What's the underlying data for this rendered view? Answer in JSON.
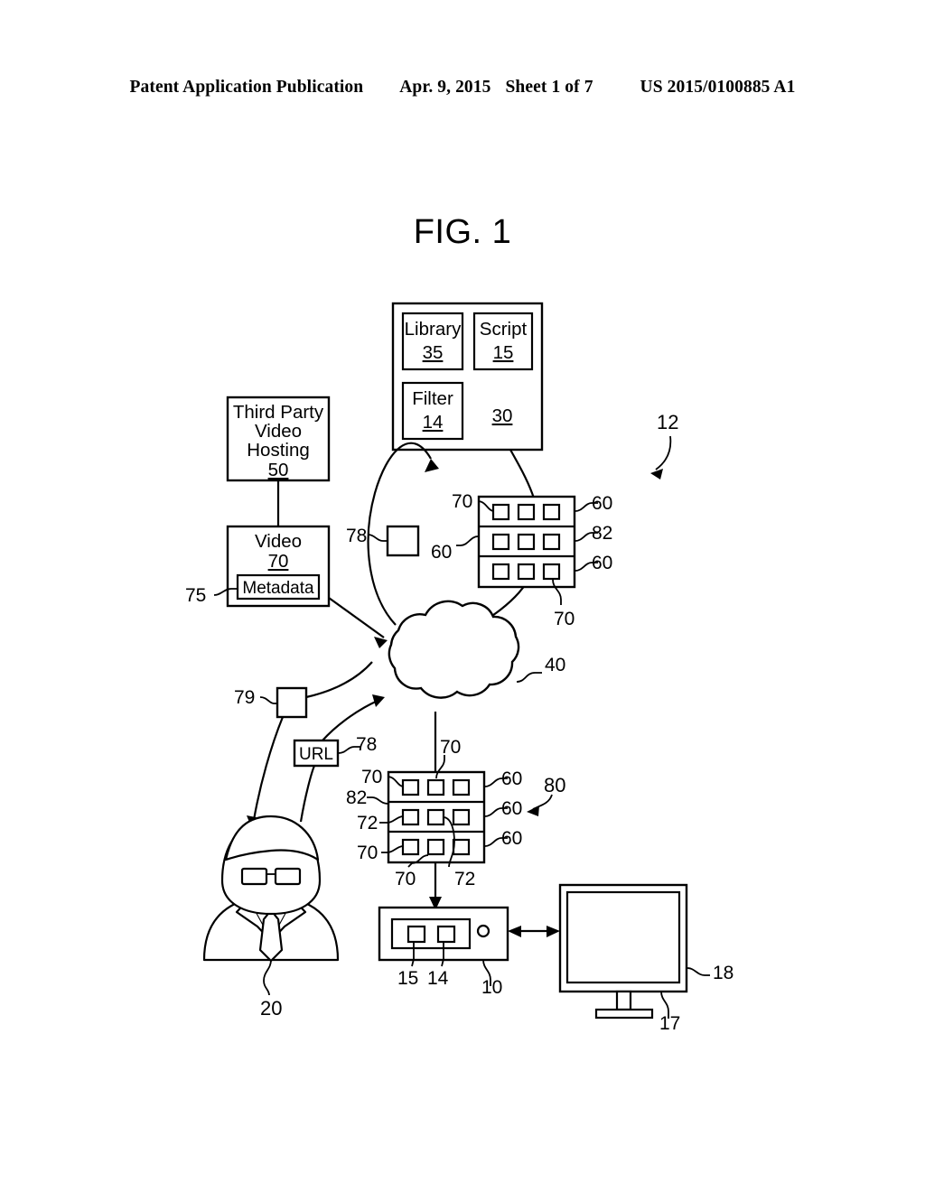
{
  "header": {
    "publication": "Patent Application Publication",
    "date": "Apr. 9, 2015",
    "sheet": "Sheet 1 of 7",
    "number": "US 2015/0100885 A1"
  },
  "figure": {
    "title": "FIG. 1",
    "system_ref": "12"
  },
  "blocks": {
    "third_party": {
      "line1": "Third Party",
      "line2": "Video",
      "line3": "Hosting",
      "ref": "50"
    },
    "video": {
      "label": "Video",
      "ref": "70",
      "metadata_label": "Metadata",
      "metadata_ref": "75"
    },
    "engine": {
      "ref": "30"
    },
    "library": {
      "label": "Library",
      "ref": "35"
    },
    "script": {
      "label": "Script",
      "ref": "15"
    },
    "filter": {
      "label": "Filter",
      "ref": "14"
    },
    "url_box": {
      "label": "URL",
      "ref": "78"
    },
    "node_box_upper": {
      "ref": "78"
    },
    "node_box_lower": {
      "ref": "79"
    },
    "cloud": {
      "ref": "40"
    },
    "user": {
      "ref": "20"
    },
    "computer": {
      "ref": "10",
      "component_a": "15",
      "component_b": "14"
    },
    "monitor": {
      "ref": "18",
      "stand_ref": "17"
    }
  },
  "rack_upper": {
    "refs": {
      "top_left": "70",
      "top_right": "60",
      "mid_left": "60",
      "mid_right": "82",
      "bottom_right": "60",
      "bottom": "70"
    }
  },
  "rack_lower": {
    "ref": "80",
    "refs": {
      "top_center": "70",
      "top_left": "70",
      "top_right": "60",
      "mid_left_a": "82",
      "mid_left_b": "72",
      "mid_right": "60",
      "bottom_right": "60",
      "bottom_left_side": "70",
      "bottom_left": "70",
      "bottom_center": "72"
    }
  }
}
